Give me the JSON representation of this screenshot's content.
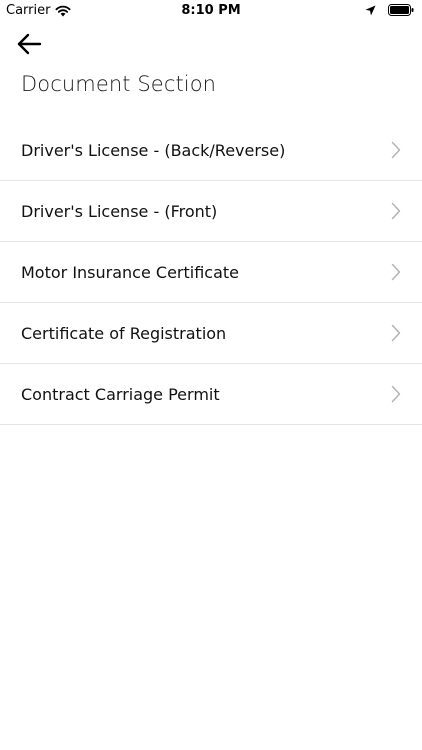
{
  "status_bar": {
    "carrier": "Carrier",
    "time": "8:10 PM"
  },
  "icons": {
    "wifi": "wifi-icon",
    "location": "location-arrow-icon",
    "battery": "battery-icon",
    "back": "arrow-left-icon",
    "chevron": "chevron-right-icon"
  },
  "page": {
    "title": "Document Section"
  },
  "documents": [
    {
      "label": "Driver's License - (Back/Reverse)"
    },
    {
      "label": "Driver's License - (Front)"
    },
    {
      "label": "Motor Insurance Certificate"
    },
    {
      "label": "Certificate of Registration"
    },
    {
      "label": "Contract Carriage Permit"
    }
  ],
  "colors": {
    "background": "#ffffff",
    "text": "#111111",
    "divider": "#e6e6e6",
    "chevron": "#b3b3b3"
  }
}
